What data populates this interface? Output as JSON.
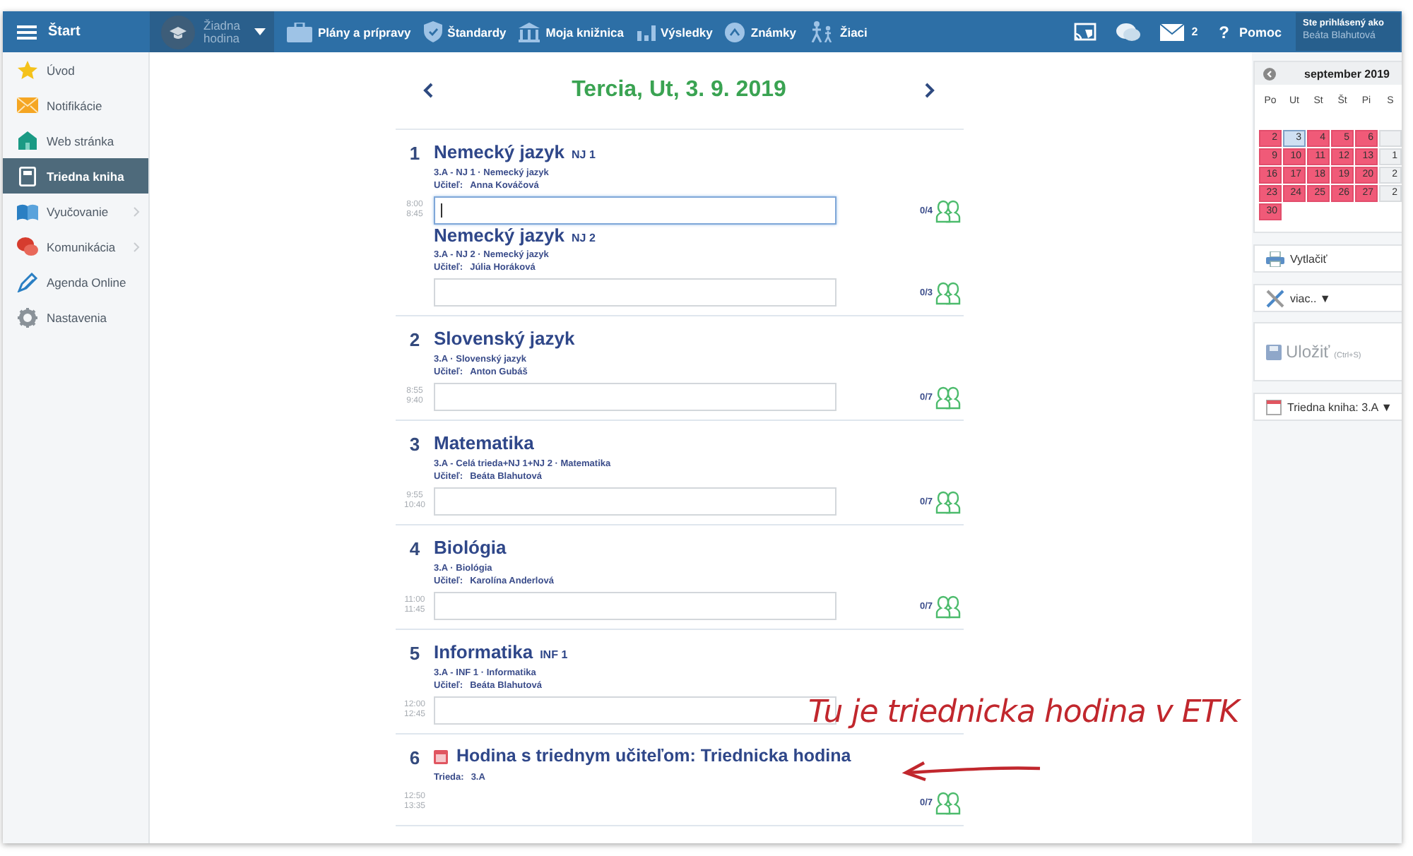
{
  "topbar": {
    "start": "Štart",
    "lesson_picker": "Žiadna hodina",
    "nav": [
      "Plány a prípravy",
      "Štandardy",
      "Moja knižnica",
      "Výsledky",
      "Známky",
      "Žiaci"
    ],
    "messages_count": "2",
    "help_mark": "?",
    "help": "Pomoc",
    "user_label": "Ste prihlásený ako",
    "user_name": "Beáta Blahutová"
  },
  "sidebar": {
    "items": [
      {
        "label": "Úvod",
        "selected": false,
        "has_submenu": false
      },
      {
        "label": "Notifikácie",
        "selected": false,
        "has_submenu": false
      },
      {
        "label": "Web stránka",
        "selected": false,
        "has_submenu": false
      },
      {
        "label": "Triedna kniha",
        "selected": true,
        "has_submenu": false
      },
      {
        "label": "Vyučovanie",
        "selected": false,
        "has_submenu": true
      },
      {
        "label": "Komunikácia",
        "selected": false,
        "has_submenu": true
      },
      {
        "label": "Agenda Online",
        "selected": false,
        "has_submenu": false
      },
      {
        "label": "Nastavenia",
        "selected": false,
        "has_submenu": false
      }
    ]
  },
  "day_title": "Tercia, Ut, 3. 9. 2019",
  "lessons": [
    {
      "number": "1",
      "time_start": "8:00",
      "time_end": "8:45",
      "entries": [
        {
          "kind": "subject",
          "title": "Nemecký jazyk",
          "group": "NJ 1",
          "info": "3.A - NJ 1 · Nemecký jazyk",
          "teacher_label": "Učiteľ:",
          "teacher": "Anna Kováčová",
          "focused": true,
          "count": "0/4"
        },
        {
          "kind": "subject",
          "title": "Nemecký jazyk",
          "group": "NJ 2",
          "info": "3.A - NJ 2 · Nemecký jazyk",
          "teacher_label": "Učiteľ:",
          "teacher": "Júlia Horáková",
          "focused": false,
          "count": "0/3"
        }
      ]
    },
    {
      "number": "2",
      "time_start": "8:55",
      "time_end": "9:40",
      "entries": [
        {
          "kind": "subject",
          "title": "Slovenský jazyk",
          "info": "3.A · Slovenský jazyk",
          "teacher_label": "Učiteľ:",
          "teacher": "Anton Gubáš",
          "focused": false,
          "count": "0/7"
        }
      ]
    },
    {
      "number": "3",
      "time_start": "9:55",
      "time_end": "10:40",
      "entries": [
        {
          "kind": "subject",
          "title": "Matematika",
          "info": "3.A - Celá trieda+NJ 1+NJ 2 · Matematika",
          "teacher_label": "Učiteľ:",
          "teacher": "Beáta Blahutová",
          "focused": false,
          "count": "0/7"
        }
      ]
    },
    {
      "number": "4",
      "time_start": "11:00",
      "time_end": "11:45",
      "entries": [
        {
          "kind": "subject",
          "title": "Biológia",
          "info": "3.A · Biológia",
          "teacher_label": "Učiteľ:",
          "teacher": "Karolína Anderlová",
          "focused": false,
          "count": "0/7"
        }
      ]
    },
    {
      "number": "5",
      "time_start": "12:00",
      "time_end": "12:45",
      "entries": [
        {
          "kind": "subject",
          "title": "Informatika",
          "group": "INF 1",
          "info": "3.A - INF 1 · Informatika",
          "teacher_label": "Učiteľ:",
          "teacher": "Beáta Blahutová",
          "focused": false
        }
      ]
    },
    {
      "number": "6",
      "time_start": "12:50",
      "time_end": "13:35",
      "entries": [
        {
          "kind": "class_hour",
          "title": "Hodina s triednym učiteľom: Triednicka hodina",
          "teacher_label": "Trieda:",
          "teacher": "3.A",
          "count": "0/7"
        }
      ]
    }
  ],
  "calendar": {
    "title": "september 2019",
    "weekdays": [
      "Po",
      "Ut",
      "St",
      "Št",
      "Pi",
      "S"
    ],
    "weeks": [
      [
        {
          "text": "2",
          "marked": true,
          "selected": false
        },
        {
          "text": "3",
          "marked": false,
          "selected": true
        },
        {
          "text": "4",
          "marked": true,
          "selected": false
        },
        {
          "text": "5",
          "marked": true,
          "selected": false
        },
        {
          "text": "6",
          "marked": true,
          "selected": false
        },
        {
          "marked": false,
          "selected": false
        }
      ],
      [
        {
          "text": "9",
          "marked": true,
          "selected": false
        },
        {
          "text": "10",
          "marked": true,
          "selected": false
        },
        {
          "text": "11",
          "marked": true,
          "selected": false
        },
        {
          "text": "12",
          "marked": true,
          "selected": false
        },
        {
          "text": "13",
          "marked": true,
          "selected": false
        },
        {
          "text": "1",
          "marked": false,
          "selected": false
        }
      ],
      [
        {
          "text": "16",
          "marked": true,
          "selected": false
        },
        {
          "text": "17",
          "marked": true,
          "selected": false
        },
        {
          "text": "18",
          "marked": true,
          "selected": false
        },
        {
          "text": "19",
          "marked": true,
          "selected": false
        },
        {
          "text": "20",
          "marked": true,
          "selected": false
        },
        {
          "text": "2",
          "marked": false,
          "selected": false
        }
      ],
      [
        {
          "text": "23",
          "marked": true,
          "selected": false
        },
        {
          "text": "24",
          "marked": true,
          "selected": false
        },
        {
          "text": "25",
          "marked": true,
          "selected": false
        },
        {
          "text": "26",
          "marked": true,
          "selected": false
        },
        {
          "text": "27",
          "marked": true,
          "selected": false
        },
        {
          "text": "2",
          "marked": false,
          "selected": false
        }
      ],
      [
        {
          "text": "30",
          "marked": true,
          "selected": false
        }
      ]
    ]
  },
  "actions": {
    "print": "Vytlačiť",
    "more": "viac.. ▼",
    "save": "Uložiť",
    "save_hint": "(Ctrl+S)",
    "book": "Triedna kniha: 3.A ▼"
  },
  "annotation": "Tu je triednicka hodina v ETK"
}
